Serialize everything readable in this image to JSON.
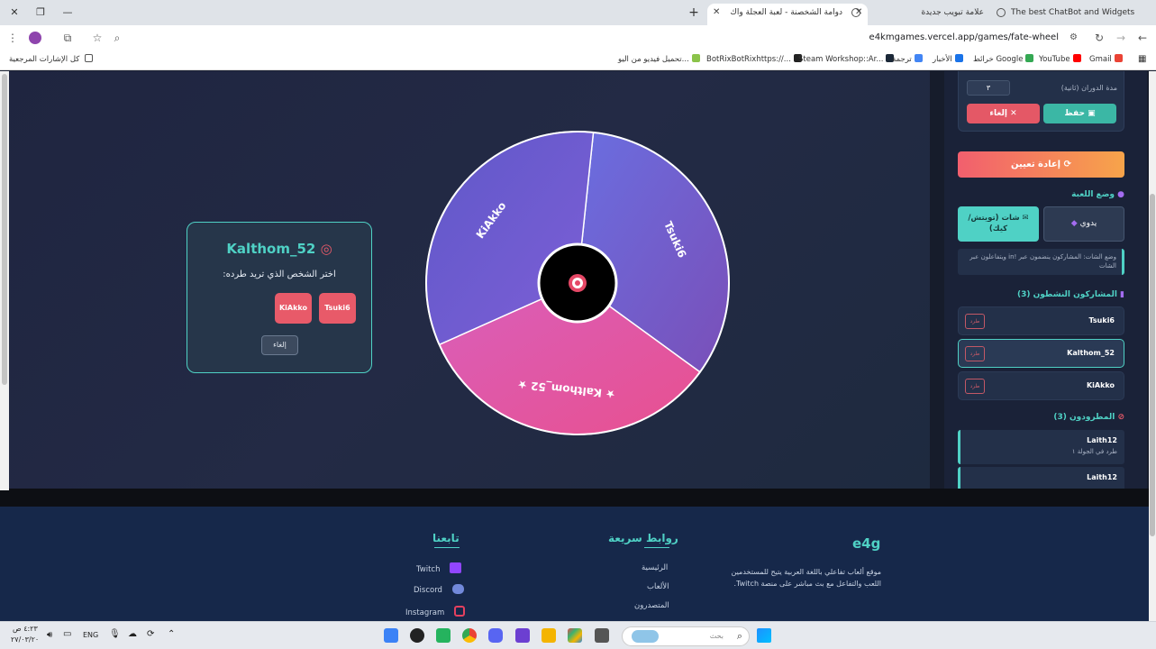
{
  "browser": {
    "tabs": [
      {
        "title": "The best ChatBot and Widgets"
      },
      {
        "title": "علامة تبويب جديدة"
      },
      {
        "title": "دوامة الشخصنة - لعبة العجلة واك"
      }
    ],
    "url": "e4kmgames.vercel.app/games/fate-wheel",
    "bookmarks": [
      "Gmail",
      "YouTube",
      "خرائط Google",
      "الأخبار",
      "ترجمة",
      "Steam Workshop::Ar...",
      "BotRixBotRixhttps://...",
      "تحميل فيديو من اليو...",
      "كل الإشارات المرجعية"
    ]
  },
  "modal": {
    "title": "Kalthom_52",
    "subtitle": "اختر الشخص الذي تريد طرده:",
    "options": [
      "Tsuki6",
      "KiAkko"
    ],
    "cancel": "إلغاء"
  },
  "wheel": {
    "segments": [
      {
        "label": "Tsuki6",
        "color_from": "#6a6ee0",
        "color_to": "#7a4fb8"
      },
      {
        "label": "★ Kalthom_52 ★",
        "color_from": "#d95fbb",
        "color_to": "#e8508f"
      },
      {
        "label": "KiAkko",
        "color_from": "#5f58c9",
        "color_to": "#7e5fd6"
      }
    ]
  },
  "sidebar": {
    "duration_label": "مدة الدوران (ثانية)",
    "duration_value": "٣",
    "save": "حفظ",
    "cancel": "إلغاء",
    "reset": "إعادة تعيين",
    "mode_title": "وضع اللعبة",
    "mode_manual": "يدوي",
    "mode_chat": "شات (تويتش/كيك)",
    "mode_desc": "وضع الشات: المشاركون ينضمون عبر !in ويتفاعلون عبر الشات",
    "active_title": "المشاركون النشطون (3)",
    "participants": [
      "Tsuki6",
      "Kalthom_52",
      "KiAkko"
    ],
    "kick_label": "طرد",
    "eliminated_title": "المطرودون (3)",
    "eliminated": [
      {
        "name": "Laith12",
        "note": "طرد في الجولة ١"
      },
      {
        "name": "Laith12",
        "note": ""
      }
    ]
  },
  "footer": {
    "brand": "e4g",
    "about": "موقع ألعاب تفاعلي باللغة العربية يتيح للمستخدمين اللعب والتفاعل مع بث مباشر على منصة Twitch.",
    "links_title": "روابط سريعة",
    "links": [
      "الرئيسية",
      "الألعاب",
      "المتصدرون"
    ],
    "follow_title": "تابعنا",
    "social": [
      "Twitch",
      "Discord",
      "Instagram"
    ]
  },
  "taskbar": {
    "search_placeholder": "بحث",
    "lang": "ENG",
    "time": "٤:٢٣ ص",
    "date": "٢٧/٠٣/٢٠"
  }
}
